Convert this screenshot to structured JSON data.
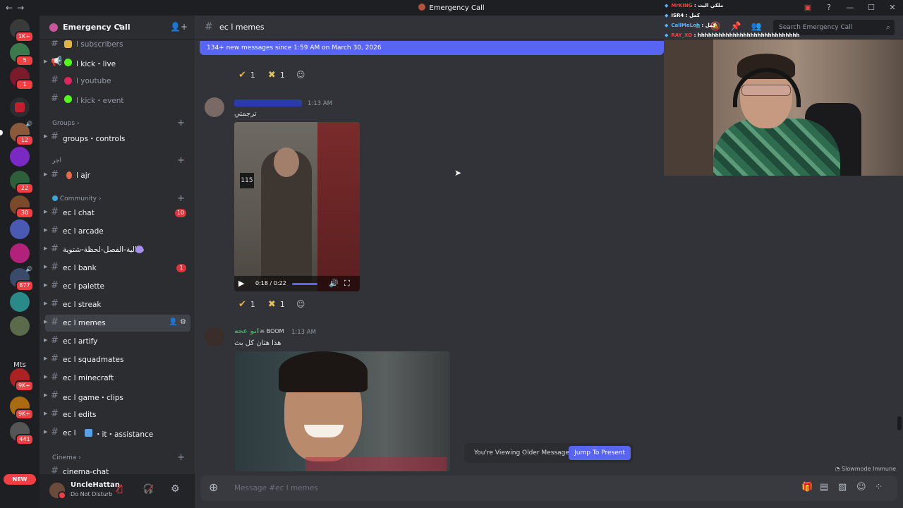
{
  "window": {
    "title": "Emergency Call",
    "nav_back": "←",
    "nav_forward": "→"
  },
  "servers": [
    {
      "badge": "1K+",
      "color": "#3a3a3a"
    },
    {
      "badge": "5",
      "color": "#3b7a4c"
    },
    {
      "badge": "1",
      "color": "#7a1a2a"
    },
    {
      "badge": "",
      "color": "#c21e2e"
    },
    {
      "badge": "12",
      "color": "#8a5a3a"
    },
    {
      "badge": "",
      "color": "#7a2ac2"
    },
    {
      "badge": "22",
      "color": "#2e5e3a"
    },
    {
      "badge": "30",
      "color": "#7a4a2a"
    },
    {
      "badge": "",
      "color": "#4a5ab2"
    },
    {
      "badge": "",
      "color": "#b2227a"
    },
    {
      "badge": "877",
      "color": "#3a4a6a"
    },
    {
      "badge": "",
      "color": "#2a8a8a"
    },
    {
      "badge": "",
      "color": "#5a6a4a"
    },
    {
      "badge": "9K+",
      "color": "#aa2222"
    },
    {
      "badge": "9K+",
      "color": "#aa6a10"
    },
    {
      "badge": "441",
      "color": "#555"
    }
  ],
  "server_mts": "Mts",
  "server_new": "NEW",
  "guild": {
    "name": "Emergency Call"
  },
  "channels": {
    "subscribers": "ا subscribers",
    "kick_live": "ا kick・live",
    "youtube": "ا youtube",
    "kick_event": "ا kick・event",
    "cat_groups": "Groups",
    "groups_controls": "groups・controls",
    "cat_ajr": "اجر",
    "ajr": "ا ajr",
    "cat_community": "Community",
    "ec_chat": "ec ا chat",
    "ec_chat_badge": "10",
    "ec_arcade": "ec ا arcade",
    "ec_event": "فعالية-الفصل-لحظة-شتوية",
    "ec_bank": "ec ا bank",
    "ec_bank_badge": "1",
    "ec_palette": "ec ا palette",
    "ec_streak": "ec ا streak",
    "ec_memes": "ec ا memes",
    "ec_artify": "ec ا artify",
    "ec_squadmates": "ec ا squadmates",
    "ec_minecraft": "ec ا minecraft",
    "ec_game_clips": "ec ا game・clips",
    "ec_edits": "ec ا edits",
    "ec_it": "ec ا",
    "ec_it_suffix": "・it・assistance",
    "cat_cinema": "Cinema",
    "cinema_chat": "cinema-chat"
  },
  "user": {
    "name": "UncleHattan",
    "status": "Do Not Disturb"
  },
  "header": {
    "channel": "ec ا memes",
    "search_placeholder": "Search Emergency Call"
  },
  "banner": "134+ new messages since 1:59 AM on March 30, 2026",
  "messages": [
    {
      "reactions": [
        {
          "count": "1"
        },
        {
          "count": "1"
        }
      ]
    },
    {
      "time": "1:13 AM",
      "text": "ترجمتي",
      "video": {
        "sign": "115",
        "time": "0:18 / 0:22",
        "progress": 0.82
      },
      "reactions": [
        {
          "count": "1"
        },
        {
          "count": "1"
        }
      ]
    },
    {
      "author": "ابو عجه",
      "author_color": "#3ba55c",
      "tag": "BOOM",
      "time": "1:13 AM",
      "text": "هذا هتان كل بث"
    }
  ],
  "older": {
    "text": "You're Viewing Older Messages",
    "jump": "Jump To Present"
  },
  "slowmode": "Slowmode Immune",
  "composer": {
    "placeholder": "Message #ec ا memes"
  },
  "overlay_chat": [
    {
      "user": "MrKING",
      "text": "ملكي البث",
      "color": "#f23f43"
    },
    {
      "user": "ISR4",
      "text": "كمل",
      "color": "#ffffff"
    },
    {
      "user": "CallMeLoh",
      "text": "كمل",
      "color": "#52b8ff"
    },
    {
      "user": "RAY_XO",
      "text": "hhhhhhhhhhhhhhhhhhhhhhhhhhhhh",
      "color": "#f23f43"
    }
  ]
}
